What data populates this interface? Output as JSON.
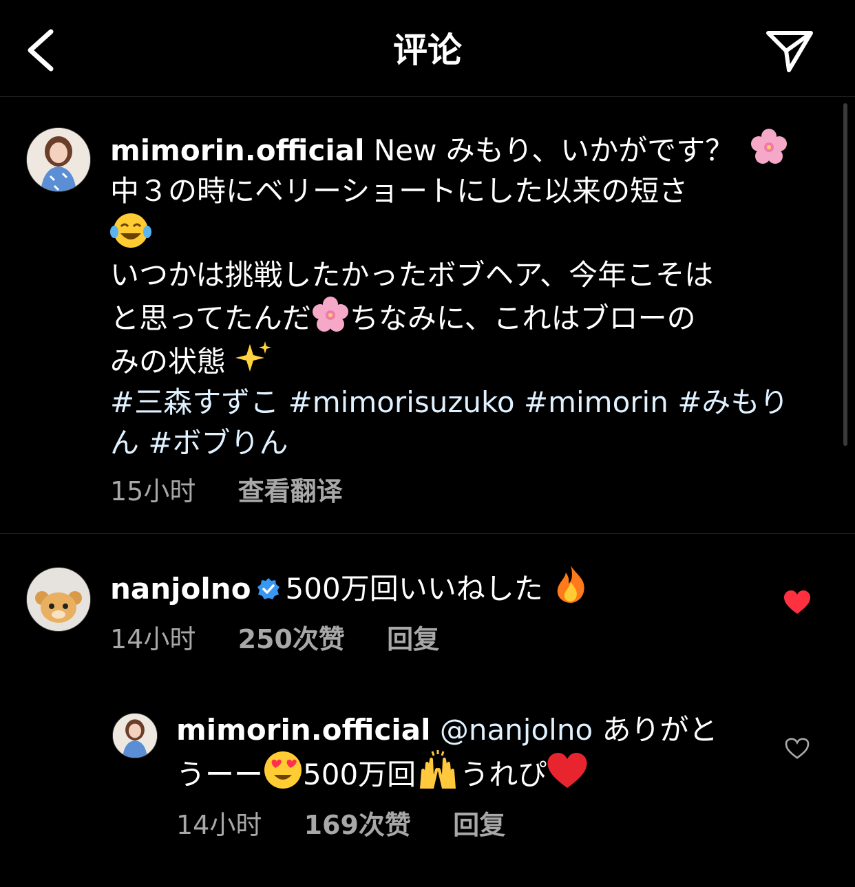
{
  "header": {
    "title": "评论",
    "back_icon": "chevron-left-icon",
    "send_icon": "paper-plane-icon"
  },
  "caption": {
    "username": "mimorin.official",
    "line1": "New みもり、いかがです？",
    "line2": "中３の時にベリーショートにした以来の短さ",
    "line3a": "いつかは挑戦したかったボブヘア、今年こそは",
    "line3b": "と思ってたんだ",
    "line3c": "ちなみに、これはブローの",
    "line4": "みの状態",
    "hashtags_line1": "#三森すずこ #mimorisuzuko #mimorin #みもり",
    "hashtags_line2": "ん #ボブりん",
    "time": "15小时",
    "translate": "查看翻译"
  },
  "comment": {
    "username": "nanjolno",
    "text": "500万回いいねした",
    "time": "14小时",
    "likes": "250次赞",
    "reply": "回复",
    "liked": true,
    "heart_color": "#ff3040"
  },
  "reply": {
    "username": "mimorin.official",
    "mention": "@nanjolno",
    "text1": "ありがと",
    "text2a": "うーー",
    "text2b": "500万回",
    "text2c": "うれぴ",
    "time": "14小时",
    "likes": "169次赞",
    "reply": "回复",
    "liked": false
  },
  "colors": {
    "background": "#000000",
    "meta": "#a8a8a8",
    "hashtag": "#e0f1ff",
    "verified": "#3897f0"
  }
}
